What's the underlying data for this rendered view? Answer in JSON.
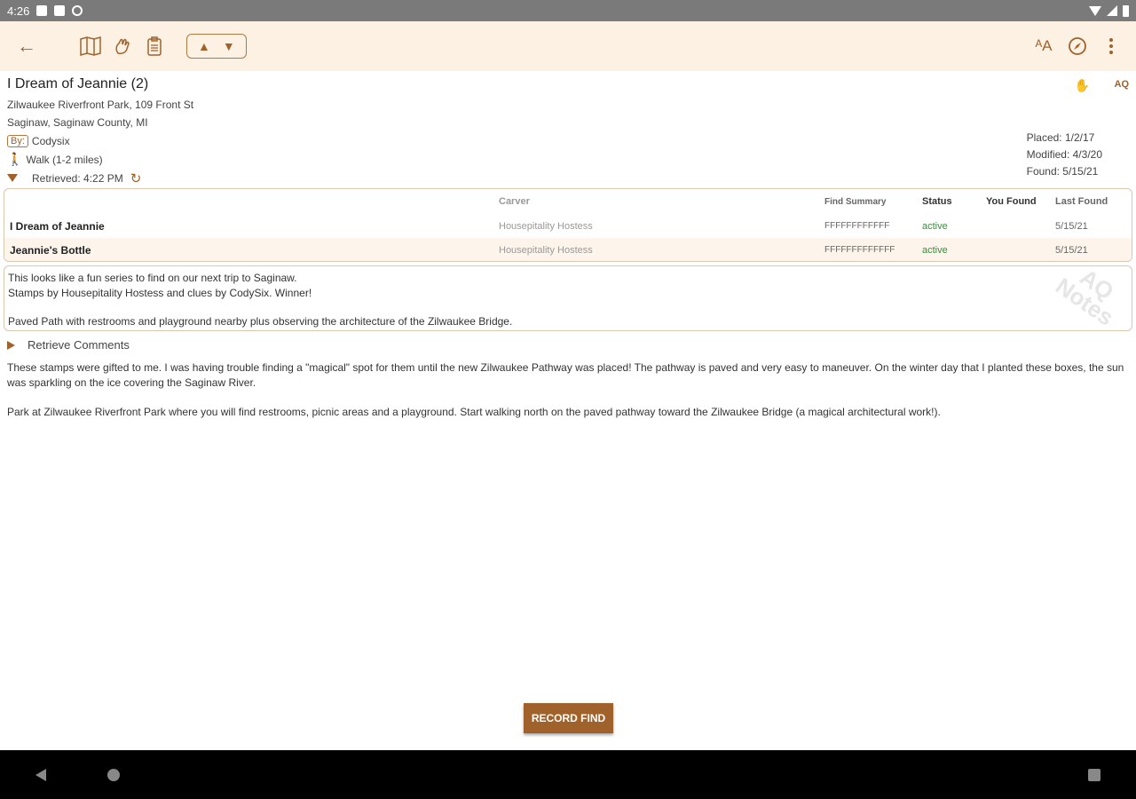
{
  "status_bar": {
    "time": "4:26"
  },
  "toolbar": {
    "up_label": "▲",
    "down_label": "▼",
    "text_size_label": "ᴬA"
  },
  "header": {
    "title": "I Dream of Jeannie (2)",
    "address_line1": "Zilwaukee Riverfront Park, 109 Front St",
    "address_line2": "Saginaw, Saginaw County, MI",
    "by_tag": "By:",
    "by_name": "Codysix",
    "walk": "Walk (1-2 miles)",
    "retrieved": "Retrieved: 4:22 PM",
    "aq_tag": "AQ",
    "placed": "Placed: 1/2/17",
    "modified": "Modified: 4/3/20",
    "found": "Found: 5/15/21"
  },
  "table": {
    "columns": [
      "",
      "Carver",
      "Find Summary",
      "Status",
      "You Found",
      "Last Found"
    ],
    "rows": [
      {
        "name": "I Dream of Jeannie",
        "carver": "Housepitality Hostess",
        "summary": "FFFFFFFFFFFF",
        "status": "active",
        "you_found": "",
        "last_found": "5/15/21"
      },
      {
        "name": "Jeannie's Bottle",
        "carver": "Housepitality Hostess",
        "summary": "FFFFFFFFFFFFF",
        "status": "active",
        "you_found": "",
        "last_found": "5/15/21"
      }
    ]
  },
  "notes": {
    "line1": "This looks like a fun series to find on our next trip to Saginaw.",
    "line2": "Stamps by Housepitality Hostess and clues by CodySix.  Winner!",
    "line3": "Paved Path with restrooms and playground nearby plus observing the architecture of the Zilwaukee Bridge.",
    "watermark_line1": "AQ",
    "watermark_line2": "Notes"
  },
  "comments": {
    "label": "Retrieve Comments"
  },
  "description": {
    "para1": "These stamps were gifted to me. I was having trouble finding a \"magical\" spot for them until the new Zilwaukee Pathway was placed! The pathway is paved and very easy to maneuver. On the winter day that I planted these boxes, the sun was sparkling on the ice covering the Saginaw River.",
    "para2": "Park at Zilwaukee Riverfront Park where you will find restrooms, picnic areas and a playground. Start walking north on the paved pathway toward the Zilwaukee Bridge (a magical architectural work!)."
  },
  "record_button": {
    "label": "RECORD FIND"
  },
  "colors": {
    "accent": "#a0622a",
    "toolbar_bg": "#fdf1e4",
    "status_active": "#3c8a3c"
  }
}
